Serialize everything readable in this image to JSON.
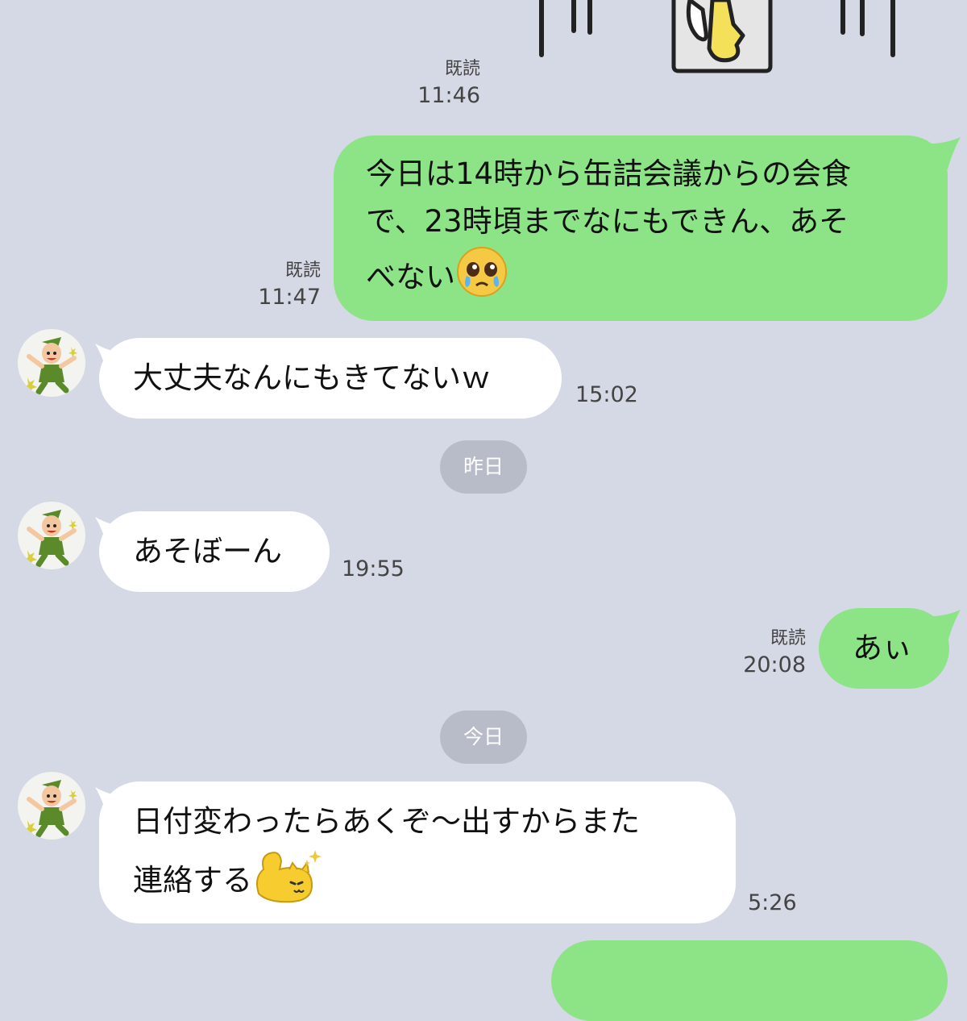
{
  "messages": [
    {
      "id": "m1",
      "direction": "outgoing",
      "read_label": "既読",
      "time": "11:46"
    },
    {
      "id": "m2",
      "direction": "outgoing",
      "lines": [
        "今日は14時から缶詰会議からの会食",
        "で、23時頃までなにもできん、あそ",
        "べない"
      ],
      "emoji": "crying-face",
      "read_label": "既読",
      "time": "11:47"
    },
    {
      "id": "m3",
      "direction": "incoming",
      "text": "大丈夫なんにもきてないｗ",
      "time": "15:02"
    },
    {
      "id": "m4",
      "direction": "incoming",
      "text": "あそぼーん",
      "time": "19:55"
    },
    {
      "id": "m5",
      "direction": "outgoing",
      "text": "あぃ",
      "read_label": "既読",
      "time": "20:08"
    },
    {
      "id": "m6",
      "direction": "incoming",
      "lines": [
        "日付変わったらあくぞ〜出すからまた",
        "連絡する"
      ],
      "emoji": "flexing-cat",
      "time": "5:26"
    }
  ],
  "date_separators": {
    "yesterday": "昨日",
    "today": "今日"
  },
  "colors": {
    "background": "#d5d9e6",
    "outgoing_bubble": "#8de487",
    "incoming_bubble": "#ffffff",
    "date_pill": "#b8bcc8"
  }
}
